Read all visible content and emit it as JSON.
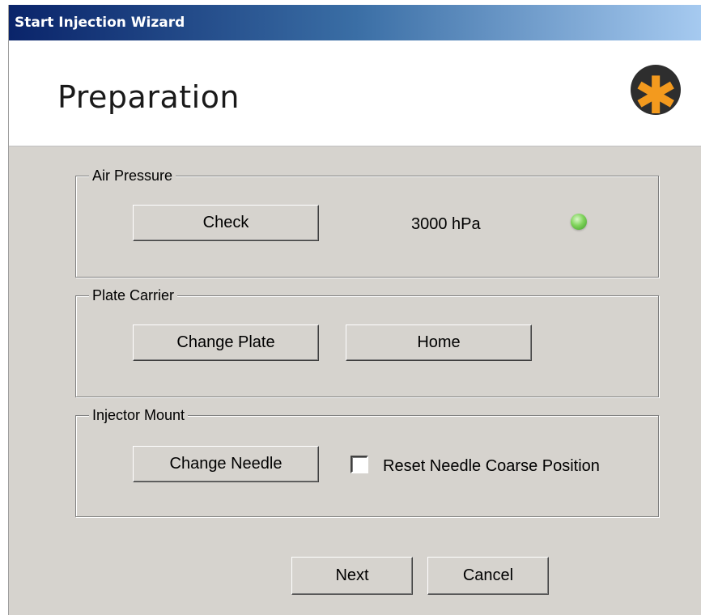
{
  "window": {
    "title": "Start Injection Wizard"
  },
  "header": {
    "title": "Preparation",
    "logo_icon": "asterisk-logo-icon",
    "logo_glyph": "✱"
  },
  "air_pressure": {
    "legend": "Air Pressure",
    "check_label": "Check",
    "value": "3000 hPa",
    "status_color": "#6ccf4a"
  },
  "plate_carrier": {
    "legend": "Plate Carrier",
    "change_plate_label": "Change Plate",
    "home_label": "Home"
  },
  "injector_mount": {
    "legend": "Injector Mount",
    "change_needle_label": "Change Needle",
    "reset_label": "Reset Needle Coarse Position",
    "reset_checked": false
  },
  "footer": {
    "next_label": "Next",
    "cancel_label": "Cancel"
  },
  "colors": {
    "title_gradient_start": "#0a246a",
    "title_gradient_end": "#a6caf0",
    "dialog_background": "#d6d3ce",
    "logo_orange": "#f39a1e"
  }
}
